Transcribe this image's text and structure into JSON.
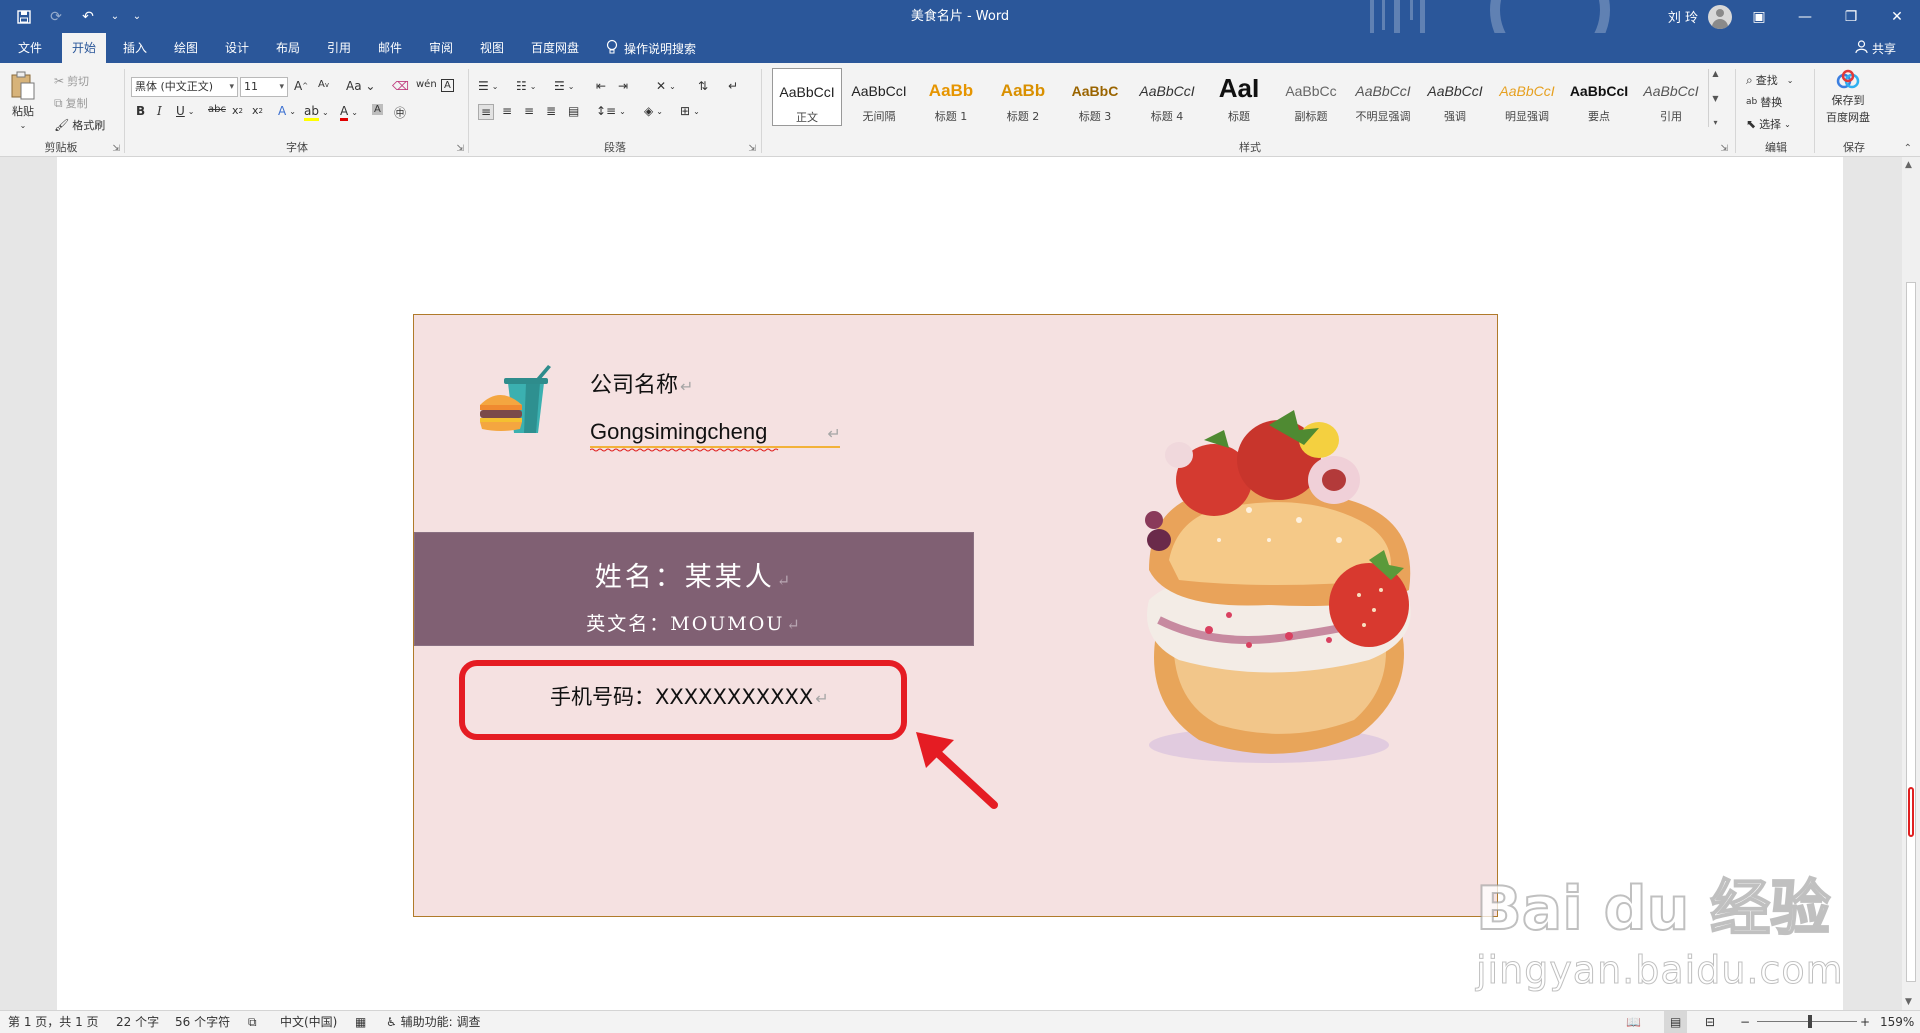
{
  "titlebar": {
    "title": "美食名片  -  Word",
    "user": "刘 玲"
  },
  "tabs": [
    "文件",
    "开始",
    "插入",
    "绘图",
    "设计",
    "布局",
    "引用",
    "邮件",
    "审阅",
    "视图",
    "百度网盘"
  ],
  "active_tab": "开始",
  "tell_me": "操作说明搜索",
  "share": "共享",
  "ribbon": {
    "clipboard": {
      "paste": "粘贴",
      "cut": "剪切",
      "copy": "复制",
      "format_painter": "格式刷",
      "label": "剪贴板"
    },
    "font": {
      "font_name": "黑体 (中文正文)",
      "font_size": "11",
      "label": "字体"
    },
    "paragraph": {
      "label": "段落"
    },
    "styles": {
      "label": "样式",
      "items": [
        {
          "sample": "AaBbCcI",
          "name": "正文",
          "color": "#222222"
        },
        {
          "sample": "AaBbCcI",
          "name": "无间隔",
          "color": "#222222"
        },
        {
          "sample": "AaBb",
          "name": "标题 1",
          "color": "#e69500"
        },
        {
          "sample": "AaBb",
          "name": "标题 2",
          "color": "#d99000"
        },
        {
          "sample": "AaBbC",
          "name": "标题 3",
          "color": "#9a6400"
        },
        {
          "sample": "AaBbCcI",
          "name": "标题 4",
          "color": "#333333"
        },
        {
          "sample": "AaI",
          "name": "标题",
          "color": "#111111"
        },
        {
          "sample": "AaBbCc",
          "name": "副标题",
          "color": "#666666"
        },
        {
          "sample": "AaBbCcI",
          "name": "不明显强调",
          "color": "#555555"
        },
        {
          "sample": "AaBbCcI",
          "name": "强调",
          "color": "#333333"
        },
        {
          "sample": "AaBbCcI",
          "name": "明显强调",
          "color": "#e6a020"
        },
        {
          "sample": "AaBbCcI",
          "name": "要点",
          "color": "#111111"
        },
        {
          "sample": "AaBbCcI",
          "name": "引用",
          "color": "#555555"
        }
      ]
    },
    "editing": {
      "find": "查找",
      "replace": "替换",
      "select": "选择",
      "label": "编辑"
    },
    "save": {
      "line1": "保存到",
      "line2": "百度网盘",
      "label": "保存"
    }
  },
  "card": {
    "company_name": "公司名称",
    "company_pinyin": "Gongsimingcheng",
    "name_line": "姓名：某某人",
    "english_name_line": "英文名：MOUMOU",
    "phone_line": "手机号码：XXXXXXXXXXX",
    "paragraph_mark": "↵",
    "band_color": "#806073",
    "card_background": "#f5e1e1",
    "highlight_color": "#e51c23"
  },
  "statusbar": {
    "page": "第 1 页，共 1 页",
    "words": "22 个字",
    "chars": "56 个字符",
    "language": "中文(中国)",
    "accessibility": "辅助功能: 调查",
    "zoom": "159%"
  },
  "watermark": {
    "logo": "Bai du 经验",
    "url": "jingyan.baidu.com"
  },
  "colors": {
    "word_blue": "#2b579a",
    "ribbon_bg": "#f3f3f3"
  }
}
